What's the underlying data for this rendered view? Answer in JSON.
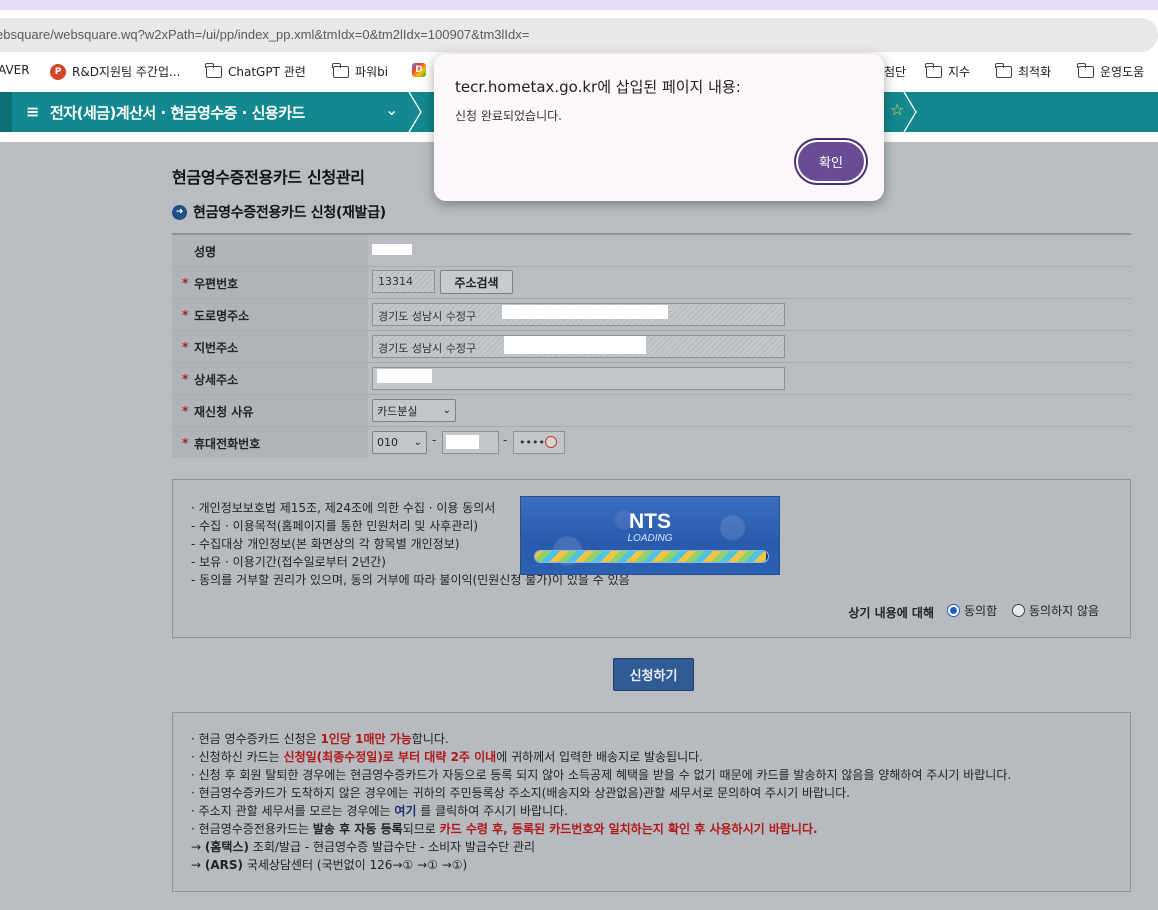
{
  "browser": {
    "url": "ebsquare/websquare.wq?w2xPath=/ui/pp/index_pp.xml&tmIdx=0&tm2lIdx=100907&tm3lIdx="
  },
  "bookmarks": [
    {
      "label": "AVER",
      "icon": "none"
    },
    {
      "label": "R&D지원팀 주간업...",
      "icon": "powerpoint-icon"
    },
    {
      "label": "ChatGPT 관련",
      "icon": "folder-icon"
    },
    {
      "label": "파워bi",
      "icon": "folder-icon"
    },
    {
      "label": "",
      "icon": "app-icon"
    },
    {
      "label": "첨단",
      "icon": "none"
    },
    {
      "label": "지수",
      "icon": "folder-icon"
    },
    {
      "label": "최적화",
      "icon": "folder-icon"
    },
    {
      "label": "운영도움",
      "icon": "folder-icon"
    }
  ],
  "nav": {
    "menu_icon": "≡",
    "title": "전자(세금)계산서 · 현금영수증 · 신용카드",
    "chevron": "⌄",
    "star": "☆"
  },
  "page": {
    "title": "현금영수증전용카드 신청관리",
    "section_title": "현금영수증전용카드 신청(재발급)"
  },
  "form": {
    "name_label": "성명",
    "postcode_label": "우편번호",
    "postcode_value": "13314",
    "address_search_button": "주소검색",
    "road_address_label": "도로명주소",
    "road_address_value": "경기도 성남시 수정구",
    "lot_address_label": "지번주소",
    "lot_address_value": "경기도 성남시 수정구",
    "detail_address_label": "상세주소",
    "reason_label": "재신청 사유",
    "reason_value": "카드분실",
    "phone_label": "휴대전화번호",
    "phone_prefix": "010",
    "phone_dash": "-",
    "phone_last_masked": "••••"
  },
  "consent": {
    "lines": [
      "· 개인정보보호법 제15조, 제24조에 의한 수집 · 이용 동의서",
      "  - 수집 · 이용목적(홈페이지를 통한 민원처리 및 사후관리)",
      "  - 수집대상 개인정보(본 화면상의 각 항목별 개인정보)",
      "  - 보유 · 이용기간(접수일로부터 2년간)",
      "  - 동의를 거부할 권리가 있으며, 동의   거부에 따라 불이익(민원신청 불가)이 있을 수 있음"
    ],
    "question": "상기 내용에 대해",
    "agree_label": "동의함",
    "disagree_label": "동의하지 않음",
    "selected": "동의함"
  },
  "loading": {
    "title": "NTS",
    "subtitle": "LOADING",
    "progress": 0.99
  },
  "submit_button": "신청하기",
  "notice": {
    "l1a": "· 현금 영수증카드 신청은 ",
    "l1b": "1인당 1매만 가능",
    "l1c": "합니다.",
    "l2a": "· 신청하신 카드는 ",
    "l2b": "신청일(최종수정일)로 부터 대략 2주 이내",
    "l2c": "에 귀하께서 입력한 배송지로 발송됩니다.",
    "l3": "· 신청 후 회원 탈퇴한 경우에는 현금영수증카드가 자동으로 등록 되지 않아 소득공제 혜택을 받을 수 없기 때문에 카드를 발송하지 않음을 양해하여 주시기 바랍니다.",
    "l4": "· 현금영수증카드가 도착하지 않은 경우에는 귀하의 주민등록상 주소지(배송지와 상관없음)관할 세무서로 문의하여 주시기 바랍니다.",
    "l5a": "· 주소지 관할 세무서를 모르는 경우에는 ",
    "l5b": "여기",
    "l5c": " 를 클릭하여 주시기 바랍니다.",
    "l6a": "· 현금영수증전용카드는 ",
    "l6b": "발송 후 자동 등록",
    "l6c": "되므로 ",
    "l6d": "카드 수령 후, 등록된 카드번호와 일치하는지 확인 후 사용하시기 바랍니다.",
    "l7a": "  → ",
    "l7b": "(홈택스)",
    "l7c": " 조회/발급 - 현금영수증 발급수단 - 소비자 발급수단 관리",
    "l8a": "  → ",
    "l8b": "(ARS)",
    "l8c": " 국세상담센터 (국번없이 126→① →① →①)"
  },
  "dialog": {
    "title": "tecr.hometax.go.kr에 삽입된 페이지 내용:",
    "message": "신청 완료되었습니다.",
    "ok_button": "확인"
  },
  "colors": {
    "nav_teal": "#13888f",
    "submit_blue": "#2f5c95",
    "dialog_button": "#6a4c95",
    "required_red": "#b02020",
    "overlay_gray": "#b9bdc1"
  }
}
